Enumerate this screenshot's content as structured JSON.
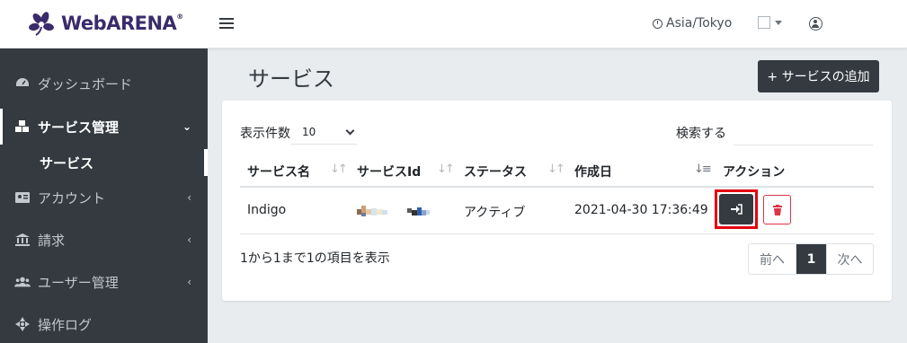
{
  "brand": {
    "name": "WebARENA",
    "mark": "®"
  },
  "header": {
    "timezone": "Asia/Tokyo"
  },
  "sidebar": {
    "items": [
      {
        "label": "ダッシュボード"
      },
      {
        "label": "サービス管理"
      },
      {
        "label": "サービス"
      },
      {
        "label": "アカウント"
      },
      {
        "label": "請求"
      },
      {
        "label": "ユーザー管理"
      },
      {
        "label": "操作ログ"
      }
    ]
  },
  "page": {
    "title": "サービス",
    "add_button": "+ サービスの追加"
  },
  "table": {
    "length_label": "表示件数",
    "length_value": "10",
    "search_label": "検索する",
    "columns": [
      "サービス名",
      "サービスId",
      "ステータス",
      "作成日",
      "アクション"
    ],
    "rows": [
      {
        "name": "Indigo",
        "status": "アクティブ",
        "created": "2021-04-30 17:36:49"
      }
    ],
    "info": "1から1まで1の項目を表示",
    "pagination": {
      "prev": "前へ",
      "current": "1",
      "next": "次へ"
    }
  },
  "colors": {
    "dark": "#343a40",
    "highlight": "#e3000f",
    "danger": "#dc3545"
  }
}
